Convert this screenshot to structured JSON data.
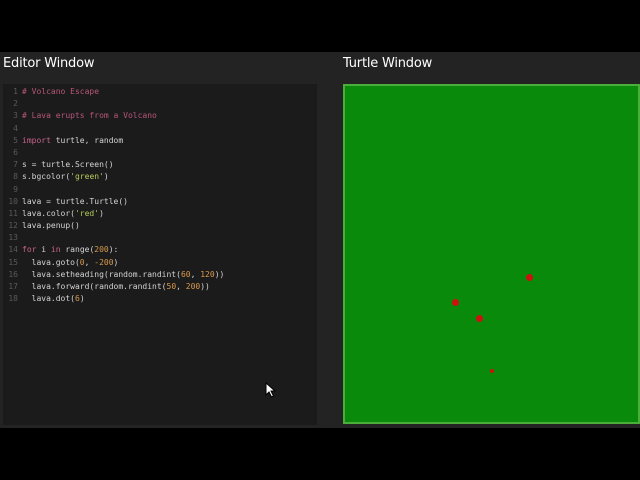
{
  "editor": {
    "title": "Editor Window",
    "lines": [
      {
        "n": "1",
        "parts": [
          {
            "t": "# Volcano Escape",
            "c": "comment"
          }
        ]
      },
      {
        "n": "2",
        "parts": []
      },
      {
        "n": "3",
        "parts": [
          {
            "t": "# Lava erupts from a Volcano",
            "c": "comment"
          }
        ]
      },
      {
        "n": "4",
        "parts": []
      },
      {
        "n": "5",
        "parts": [
          {
            "t": "import",
            "c": "kw"
          },
          {
            "t": " turtle, random",
            "c": "fn"
          }
        ]
      },
      {
        "n": "6",
        "parts": []
      },
      {
        "n": "7",
        "parts": [
          {
            "t": "s = turtle.Screen()",
            "c": "fn"
          }
        ]
      },
      {
        "n": "8",
        "parts": [
          {
            "t": "s.bgcolor(",
            "c": "fn"
          },
          {
            "t": "'green'",
            "c": "str"
          },
          {
            "t": ")",
            "c": "fn"
          }
        ]
      },
      {
        "n": "9",
        "parts": []
      },
      {
        "n": "10",
        "parts": [
          {
            "t": "lava = turtle.Turtle()",
            "c": "fn"
          }
        ]
      },
      {
        "n": "11",
        "parts": [
          {
            "t": "lava.color(",
            "c": "fn"
          },
          {
            "t": "'red'",
            "c": "str"
          },
          {
            "t": ")",
            "c": "fn"
          }
        ]
      },
      {
        "n": "12",
        "parts": [
          {
            "t": "lava.penup()",
            "c": "fn"
          }
        ]
      },
      {
        "n": "13",
        "parts": []
      },
      {
        "n": "14",
        "parts": [
          {
            "t": "for",
            "c": "kw"
          },
          {
            "t": " i ",
            "c": "fn"
          },
          {
            "t": "in",
            "c": "kw"
          },
          {
            "t": " range(",
            "c": "fn"
          },
          {
            "t": "200",
            "c": "num"
          },
          {
            "t": "):",
            "c": "fn"
          }
        ]
      },
      {
        "n": "15",
        "parts": [
          {
            "t": "  lava.goto(",
            "c": "fn"
          },
          {
            "t": "0",
            "c": "num"
          },
          {
            "t": ", ",
            "c": "fn"
          },
          {
            "t": "-200",
            "c": "num"
          },
          {
            "t": ")",
            "c": "fn"
          }
        ]
      },
      {
        "n": "16",
        "parts": [
          {
            "t": "  lava.setheading(random.randint(",
            "c": "fn"
          },
          {
            "t": "60",
            "c": "num"
          },
          {
            "t": ", ",
            "c": "fn"
          },
          {
            "t": "120",
            "c": "num"
          },
          {
            "t": "))",
            "c": "fn"
          }
        ]
      },
      {
        "n": "17",
        "parts": [
          {
            "t": "  lava.forward(random.randint(",
            "c": "fn"
          },
          {
            "t": "50",
            "c": "num"
          },
          {
            "t": ", ",
            "c": "fn"
          },
          {
            "t": "200",
            "c": "num"
          },
          {
            "t": "))",
            "c": "fn"
          }
        ]
      },
      {
        "n": "18",
        "parts": [
          {
            "t": "  lava.dot(",
            "c": "fn"
          },
          {
            "t": "6",
            "c": "num"
          },
          {
            "t": ")",
            "c": "fn"
          }
        ]
      }
    ]
  },
  "turtle_window": {
    "title": "Turtle Window",
    "background": "#0a8a0a",
    "dot_color": "#cc1111"
  }
}
